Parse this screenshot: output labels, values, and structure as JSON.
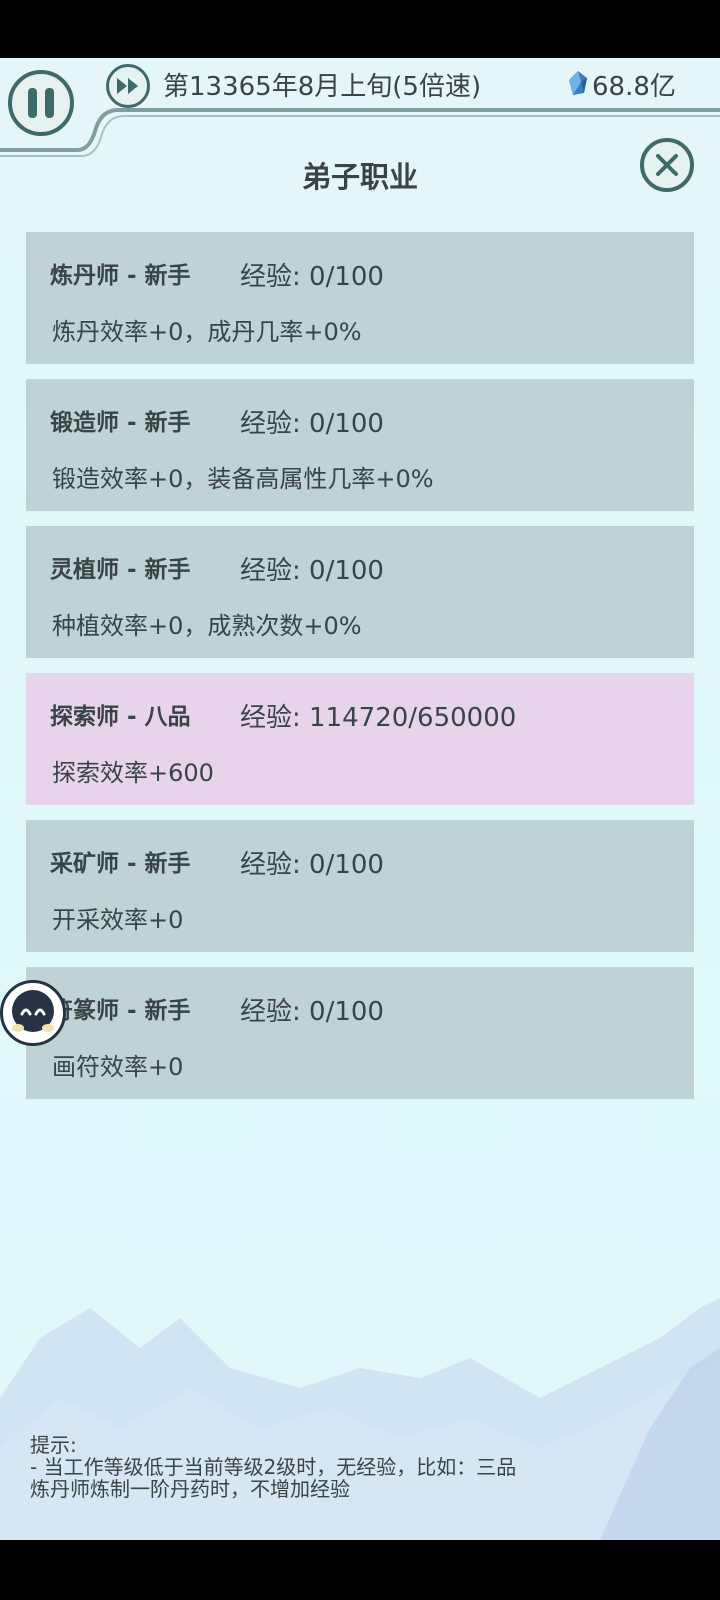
{
  "topbar": {
    "date": "第13365年8月上旬(5倍速)",
    "spirit_stones": "68.8亿"
  },
  "panel": {
    "title": "弟子职业"
  },
  "professions": [
    {
      "name": "炼丹师 - 新手",
      "exp": "经验: 0/100",
      "desc": "炼丹效率+0，成丹几率+0%"
    },
    {
      "name": "锻造师 - 新手",
      "exp": "经验: 0/100",
      "desc": "锻造效率+0，装备高属性几率+0%"
    },
    {
      "name": "灵植师 - 新手",
      "exp": "经验: 0/100",
      "desc": "种植效率+0，成熟次数+0%"
    },
    {
      "name": "探索师 - 八品",
      "exp": "经验: 114720/650000",
      "desc": "探索效率+600"
    },
    {
      "name": "采矿师 - 新手",
      "exp": "经验: 0/100",
      "desc": "开采效率+0"
    },
    {
      "name": "符篆师 - 新手",
      "exp": "经验: 0/100",
      "desc": "画符效率+0"
    }
  ],
  "tips": {
    "heading": "提示:",
    "line1": "- 当工作等级低于当前等级2级时，无经验，比如：三品",
    "line2": "炼丹师炼制一阶丹药时，不增加经验"
  },
  "colors": {
    "card_default": "#bfd3d4",
    "card_highlight": "#e8d4ea",
    "accent": "#3e6a6a"
  }
}
